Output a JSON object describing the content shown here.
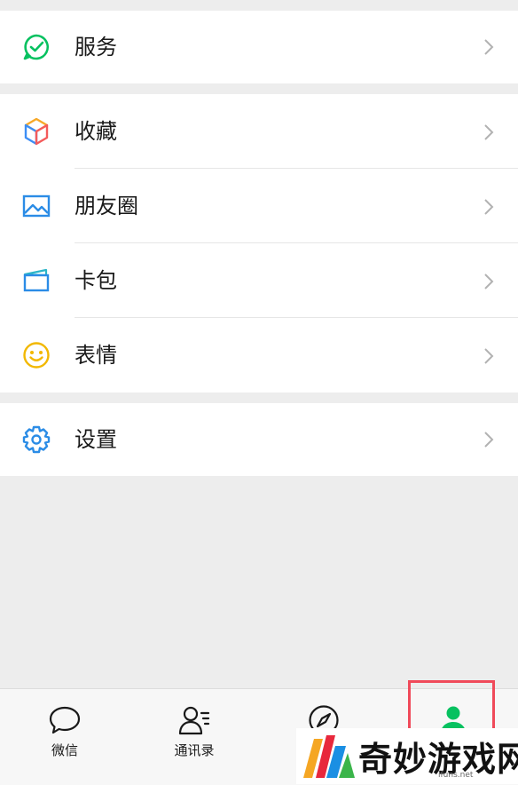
{
  "menu": {
    "services": {
      "label": "服务",
      "icon": "services-icon"
    },
    "favorites": {
      "label": "收藏",
      "icon": "favorites-cube-icon"
    },
    "moments": {
      "label": "朋友圈",
      "icon": "moments-picture-icon"
    },
    "cards": {
      "label": "卡包",
      "icon": "card-wallet-icon"
    },
    "stickers": {
      "label": "表情",
      "icon": "smiley-icon"
    },
    "settings": {
      "label": "设置",
      "icon": "gear-icon"
    }
  },
  "tabbar": {
    "tabs": [
      {
        "label": "微信",
        "icon": "chat-bubble-icon"
      },
      {
        "label": "通讯录",
        "icon": "contacts-icon"
      },
      {
        "label": "",
        "icon": "compass-icon"
      },
      {
        "label": "",
        "icon": "me-person-icon",
        "active": true
      }
    ]
  },
  "watermark": {
    "title": "奇妙游戏网",
    "url": "ifuns.net"
  },
  "colors": {
    "wechat_green": "#07c160",
    "highlight_red": "#f04a5a",
    "background": "#ededed"
  }
}
